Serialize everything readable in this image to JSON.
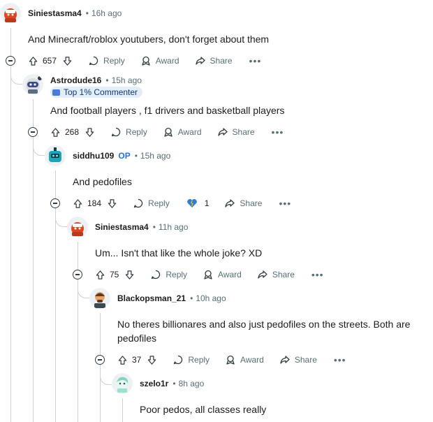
{
  "comments": [
    {
      "author": "Siniestasma4",
      "op": "",
      "time": "16h ago",
      "flair": "",
      "text": "And Minecraft/roblox youtubers, don't forget about them",
      "votes": "657",
      "award_count": ""
    },
    {
      "author": "Astrodude16",
      "op": "",
      "time": "15h ago",
      "flair": "Top 1% Commenter",
      "text": "And football players , f1 drivers and basketball players",
      "votes": "268",
      "award_count": ""
    },
    {
      "author": "siddhu109",
      "op": "OP",
      "time": "15h ago",
      "flair": "",
      "text": "And pedofiles",
      "votes": "184",
      "award_count": "1"
    },
    {
      "author": "Siniestasma4",
      "op": "",
      "time": "11h ago",
      "flair": "",
      "text": "Um... Isn't that like the whole joke? XD",
      "votes": "75",
      "award_count": ""
    },
    {
      "author": "Blackopsman_21",
      "op": "",
      "time": "10h ago",
      "flair": "",
      "text": "No theres billionares and also just pedofiles on the streets. Both are pedofiles",
      "votes": "37",
      "award_count": ""
    },
    {
      "author": "szelo1r",
      "op": "",
      "time": "8h ago",
      "flair": "",
      "text": "Poor pedos, all classes really",
      "votes": "",
      "award_count": ""
    }
  ],
  "actions": {
    "reply": "Reply",
    "award": "Award",
    "share": "Share",
    "more": "•••",
    "separator": "•"
  },
  "colors": {
    "thread_line": "#c7d1d8",
    "meta_gray": "#576f76",
    "flair_bg": "#e4eefb",
    "op_blue": "#2a6fd6"
  },
  "icons": [
    "upvote-icon",
    "downvote-icon",
    "reply-icon",
    "award-icon",
    "share-icon",
    "collapse-icon",
    "award-heart-icon"
  ]
}
